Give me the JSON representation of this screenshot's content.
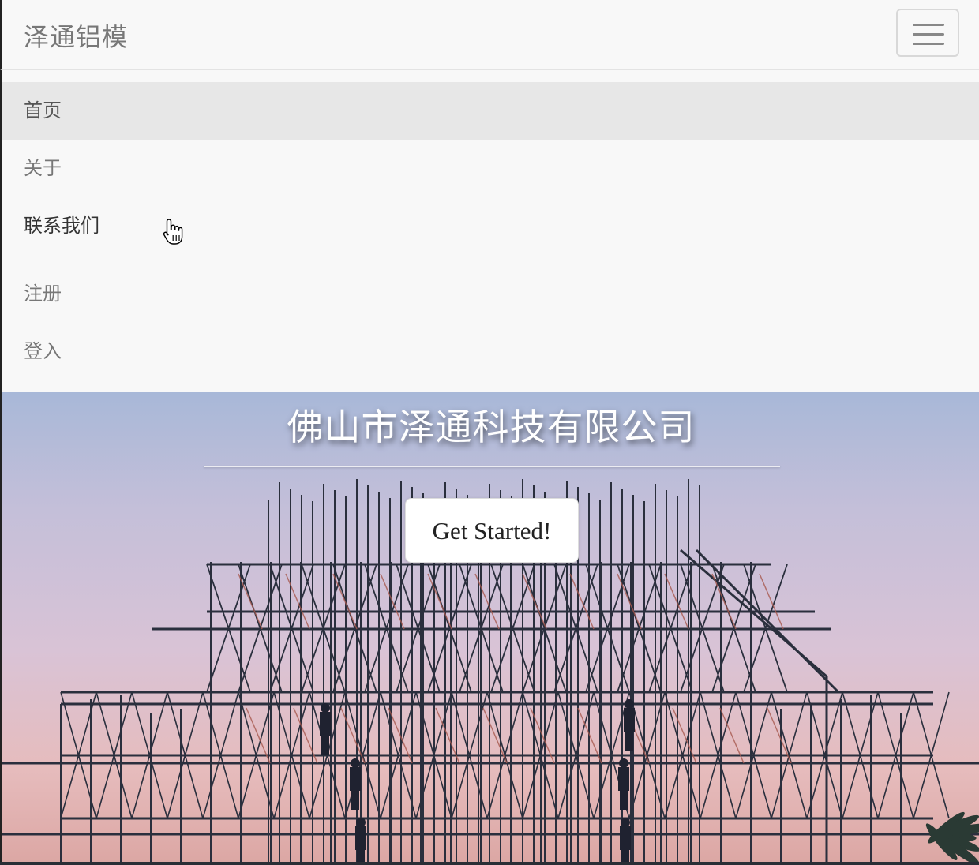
{
  "navbar": {
    "brand": "泽通铝模",
    "toggle_icon": "hamburger-menu-icon"
  },
  "menu": {
    "items": [
      {
        "label": "首页",
        "state": "active"
      },
      {
        "label": "关于",
        "state": "normal"
      },
      {
        "label": "联系我们",
        "state": "hover"
      },
      {
        "label": "注册",
        "state": "normal"
      },
      {
        "label": "登入",
        "state": "normal"
      }
    ]
  },
  "hero": {
    "title": "佛山市泽通科技有限公司",
    "cta_label": "Get Started!"
  },
  "colors": {
    "navbar_bg": "#f8f8f8",
    "active_item_bg": "#e7e7e7",
    "muted_text": "#777777"
  }
}
